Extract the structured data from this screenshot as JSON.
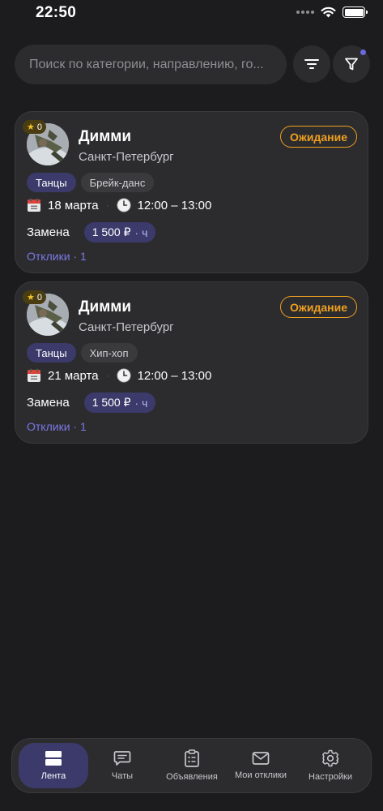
{
  "status_bar": {
    "time": "22:50"
  },
  "search": {
    "placeholder": "Поиск по категории, направлению, го..."
  },
  "colors": {
    "background": "#1c1c1e",
    "card": "#2c2c2e",
    "accent": "#3b3a6b",
    "link": "#7b78e5",
    "pending": "#f0a020"
  },
  "icons": {
    "sort": "sort-lines-icon",
    "filter": "funnel-icon"
  },
  "listings": [
    {
      "name": "Димми",
      "city": "Санкт-Петербург",
      "rating": "0",
      "status": "Ожидание",
      "category": "Танцы",
      "style": "Брейк-данс",
      "date": "18 марта",
      "time": "12:00 – 13:00",
      "type": "Замена",
      "price": "1 500 ₽",
      "price_unit": "· ч",
      "responses": "Отклики · 1"
    },
    {
      "name": "Димми",
      "city": "Санкт-Петербург",
      "rating": "0",
      "status": "Ожидание",
      "category": "Танцы",
      "style": "Хип-хоп",
      "date": "21 марта",
      "time": "12:00 – 13:00",
      "type": "Замена",
      "price": "1 500 ₽",
      "price_unit": "· ч",
      "responses": "Отклики · 1"
    }
  ],
  "tabbar": {
    "active": "Лента",
    "items": [
      {
        "label": "Лента",
        "icon": "feed-icon"
      },
      {
        "label": "Чаты",
        "icon": "chat-icon"
      },
      {
        "label": "Объявления",
        "icon": "clipboard-icon"
      },
      {
        "label": "Мои отклики",
        "icon": "mail-icon"
      },
      {
        "label": "Настройки",
        "icon": "gear-icon"
      }
    ]
  }
}
